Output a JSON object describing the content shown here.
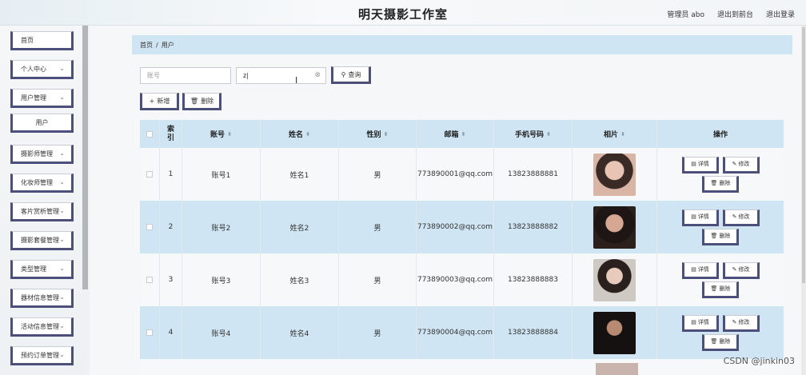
{
  "header": {
    "title": "明天摄影工作室",
    "admin_label": "管理员 abo",
    "back_front_label": "退出到前台",
    "logout_label": "退出登录"
  },
  "sidebar": {
    "items": [
      {
        "label": "首页",
        "icon": "chevron-down-icon",
        "has_chevron": false
      },
      {
        "label": "个人中心",
        "icon": "chevron-down-icon",
        "has_chevron": true
      },
      {
        "label": "用户管理",
        "icon": "chevron-down-icon",
        "has_chevron": true
      },
      {
        "label": "用户",
        "icon": "",
        "has_chevron": false
      },
      {
        "label": "摄影师管理",
        "icon": "chevron-down-icon",
        "has_chevron": true
      },
      {
        "label": "化妆师管理",
        "icon": "chevron-down-icon",
        "has_chevron": true
      },
      {
        "label": "客片赏析管理",
        "icon": "chevron-down-icon",
        "has_chevron": true
      },
      {
        "label": "摄影套餐管理",
        "icon": "chevron-down-icon",
        "has_chevron": true
      },
      {
        "label": "类型管理",
        "icon": "chevron-down-icon",
        "has_chevron": true
      },
      {
        "label": "器材信息管理",
        "icon": "chevron-down-icon",
        "has_chevron": true
      },
      {
        "label": "活动信息管理",
        "icon": "chevron-down-icon",
        "has_chevron": true
      },
      {
        "label": "预约订单管理",
        "icon": "chevron-down-icon",
        "has_chevron": true
      }
    ]
  },
  "breadcrumb": {
    "home": "首页",
    "sep": "/",
    "current": "用户"
  },
  "search": {
    "account_placeholder": "账号",
    "name_value": "z",
    "query_label": "查询",
    "add_label": "新增",
    "delete_label": "删除"
  },
  "table": {
    "headers": [
      "索引",
      "账号",
      "姓名",
      "性别",
      "邮箱",
      "手机号码",
      "相片",
      "操作"
    ],
    "rows": [
      {
        "index": "1",
        "account": "账号1",
        "name": "姓名1",
        "gender": "男",
        "email": "773890001@qq.com",
        "phone": "13823888881"
      },
      {
        "index": "2",
        "account": "账号2",
        "name": "姓名2",
        "gender": "男",
        "email": "773890002@qq.com",
        "phone": "13823888882"
      },
      {
        "index": "3",
        "account": "账号3",
        "name": "姓名3",
        "gender": "男",
        "email": "773890003@qq.com",
        "phone": "13823888883"
      },
      {
        "index": "4",
        "account": "账号4",
        "name": "姓名4",
        "gender": "男",
        "email": "773890004@qq.com",
        "phone": "13823888884"
      }
    ],
    "ops": {
      "detail": "详情",
      "edit": "修改",
      "delete": "删除"
    }
  },
  "watermark": "CSDN @jinkin03",
  "colors": {
    "accent": "#4b4f7a",
    "header_bg": "#cfe5f3"
  }
}
